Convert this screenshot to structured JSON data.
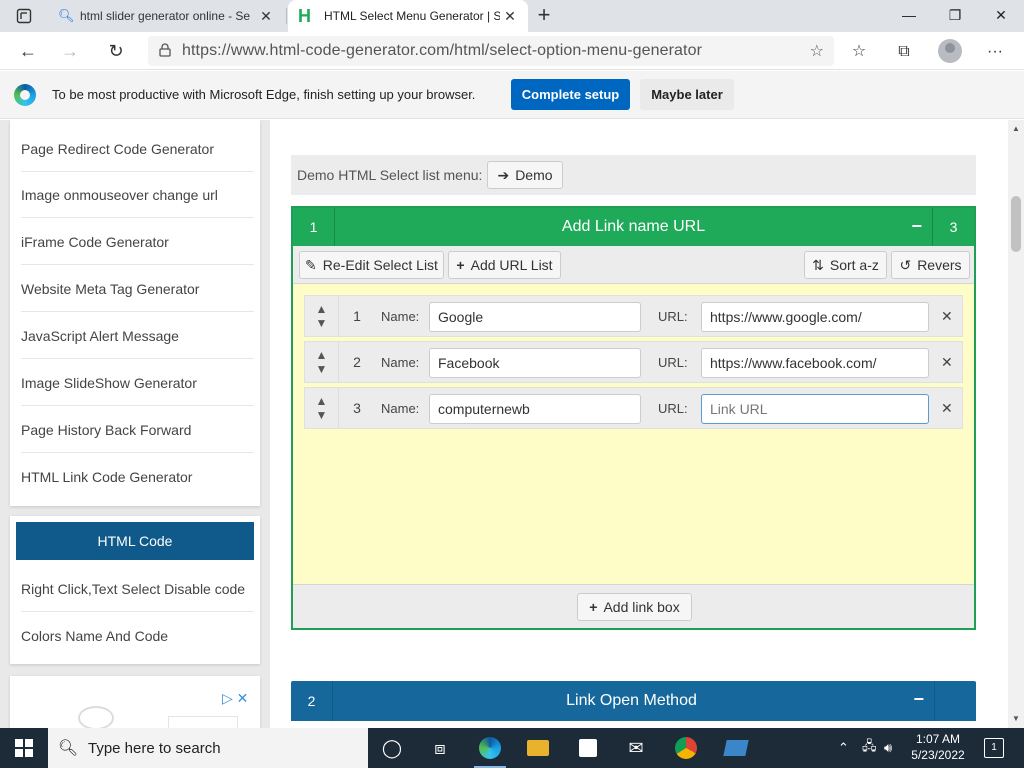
{
  "browser": {
    "tabs": [
      {
        "title": "html slider generator online - Se",
        "active": false
      },
      {
        "title": "HTML Select Menu Generator | S",
        "active": true
      }
    ],
    "address": "https://www.html-code-generator.com/html/select-option-menu-generator",
    "window_controls": {
      "minimize": "—",
      "restore": "❐",
      "close": "✕"
    }
  },
  "infobar": {
    "message": "To be most productive with Microsoft Edge, finish setting up your browser.",
    "complete_button": "Complete setup",
    "later_button": "Maybe later"
  },
  "sidebar": {
    "links": [
      "Page Redirect Code Generator",
      "Image onmouseover change url",
      "iFrame Code Generator",
      "Website Meta Tag Generator",
      "JavaScript Alert Message",
      "Image SlideShow Generator",
      "Page History Back Forward",
      "HTML Link Code Generator"
    ],
    "section_header": "HTML Code",
    "section_links": [
      "Right Click,Text Select Disable code",
      "Colors Name And Code"
    ]
  },
  "demo": {
    "label": "Demo HTML Select list menu:",
    "button": "Demo"
  },
  "panel": {
    "step": "1",
    "title": "Add Link name URL",
    "minimize": "−",
    "count": "3",
    "tools": {
      "reedit": "Re-Edit Select List",
      "add_url_list": "Add URL List",
      "sort": "Sort a-z",
      "revers": "Revers"
    },
    "name_label": "Name:",
    "url_label": "URL:",
    "url_placeholder": "Link URL",
    "rows": [
      {
        "index": "1",
        "name": "Google",
        "url": "https://www.google.com/"
      },
      {
        "index": "2",
        "name": "Facebook",
        "url": "https://www.facebook.com/"
      },
      {
        "index": "3",
        "name": "computernewb",
        "url": ""
      }
    ],
    "add_box": "Add link box"
  },
  "panel2": {
    "step": "2",
    "title": "Link Open Method",
    "minimize": "−"
  },
  "taskbar": {
    "search_placeholder": "Type here to search",
    "time": "1:07 AM",
    "date": "5/23/2022",
    "notifications": "1"
  },
  "colors": {
    "panel_green": "#1faa5a",
    "panel_yellow": "#fffdc7",
    "panel_blue": "#16689c",
    "edge_blue": "#0067c0"
  }
}
